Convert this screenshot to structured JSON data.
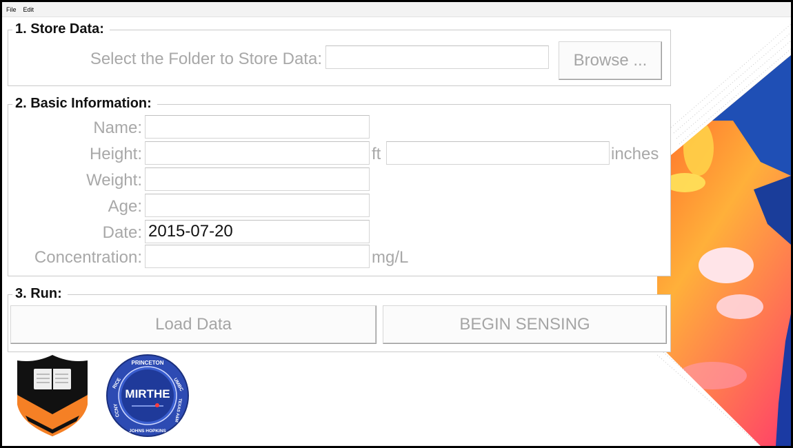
{
  "menubar": {
    "items": [
      "File",
      "Edit"
    ]
  },
  "store": {
    "title": "1. Store Data:",
    "folder_label": "Select the Folder to Store Data:",
    "folder_value": "",
    "browse_label": "Browse ..."
  },
  "basic": {
    "title": "2. Basic Information:",
    "name_label": "Name:",
    "name_value": "",
    "height_label": "Height:",
    "height_ft_value": "",
    "height_ft_unit": "ft",
    "height_in_value": "",
    "height_in_unit": "inches",
    "weight_label": "Weight:",
    "weight_value": "",
    "age_label": "Age:",
    "age_value": "",
    "date_label": "Date:",
    "date_value": "2015-07-20",
    "concentration_label": "Concentration:",
    "concentration_value": "",
    "concentration_unit": "mg/L"
  },
  "run": {
    "title": "3. Run:",
    "load_label": "Load Data",
    "begin_label": "BEGIN SENSING"
  },
  "logos": {
    "mirthe_text": "MIRTHE",
    "mirthe_ring": [
      "PRINCETON",
      "UMBC",
      "TEXAS A&M",
      "JOHNS HOPKINS",
      "CCNY",
      "RICE"
    ]
  },
  "colors": {
    "princeton_orange": "#f58025",
    "mirthe_blue": "#2d4bb3",
    "label_gray": "#a8a8a8"
  }
}
